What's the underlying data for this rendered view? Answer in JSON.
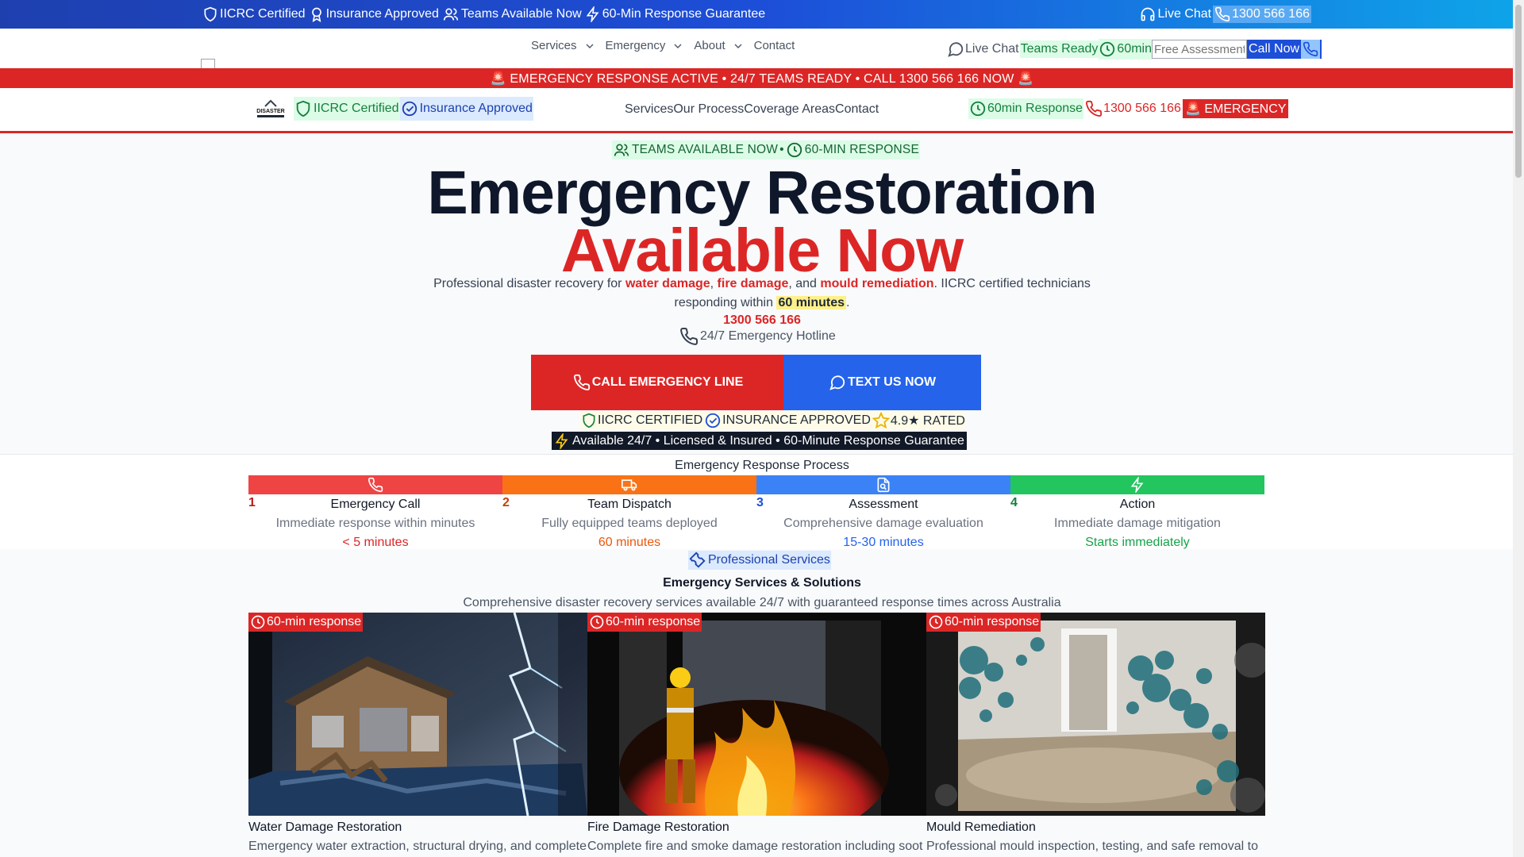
{
  "topbar": {
    "badges": [
      "IICRC Certified",
      "Insurance Approved",
      "Teams Available Now",
      "60-Min Response Guarantee"
    ],
    "live_chat": "Live Chat",
    "phone": "1300 566 166"
  },
  "nav": {
    "links": [
      "Services",
      "Emergency",
      "About",
      "Contact"
    ],
    "live_chat": "Live Chat",
    "teams_ready": "Teams Ready",
    "sixty_min": "60min",
    "free_assessment_placeholder": "Free Assessment",
    "call_now": "Call Now"
  },
  "alert_banner": "🚨 EMERGENCY RESPONSE ACTIVE • 24/7 TEAMS READY • CALL 1300 566 166 NOW 🚨",
  "subheader": {
    "logo_text": "DISASTER",
    "badges": [
      "IICRC Certified",
      "Insurance Approved"
    ],
    "links": [
      "Services",
      "Our Process",
      "Coverage Areas",
      "Contact"
    ],
    "response": "60min Response",
    "phone": "1300 566 166",
    "emergency": "🚨 EMERGENCY"
  },
  "hero": {
    "pill_left": "TEAMS AVAILABLE NOW",
    "pill_sep": "•",
    "pill_right": "60-MIN RESPONSE",
    "title_line1": "Emergency Restoration",
    "title_line2": "Available Now",
    "lead_1": "Professional disaster recovery for ",
    "lead_water": "water damage",
    "lead_2": ", ",
    "lead_fire": "fire damage",
    "lead_3": ", and ",
    "lead_mould": "mould remediation",
    "lead_4": ". IICRC certified technicians responding within ",
    "lead_time": "60 minutes",
    "lead_5": ".",
    "hotline_number": "1300 566 166",
    "hotline_label": "24/7 Emergency Hotline",
    "cta_call": "CALL EMERGENCY LINE",
    "cta_text": "TEXT US NOW",
    "trust": [
      "IICRC CERTIFIED",
      "INSURANCE APPROVED",
      "4.9★ RATED"
    ],
    "strip": "Available 24/7 • Licensed & Insured • 60-Minute Response Guarantee"
  },
  "process": {
    "title": "Emergency Response Process",
    "steps": [
      {
        "num": "1",
        "name": "Emergency Call",
        "desc": "Immediate response within minutes",
        "time": "< 5 minutes",
        "color": "#ef4444",
        "icon": "phone-icon"
      },
      {
        "num": "2",
        "name": "Team Dispatch",
        "desc": "Fully equipped teams deployed",
        "time": "60 minutes",
        "color": "#f97316",
        "icon": "truck-icon"
      },
      {
        "num": "3",
        "name": "Assessment",
        "desc": "Comprehensive damage evaluation",
        "time": "15-30 minutes",
        "color": "#3b82f6",
        "icon": "file-search-icon"
      },
      {
        "num": "4",
        "name": "Action",
        "desc": "Immediate damage mitigation",
        "time": "Starts immediately",
        "color": "#22c55e",
        "icon": "zap-icon"
      }
    ]
  },
  "services": {
    "pill": "Professional Services",
    "title": "Emergency Services & Solutions",
    "subtitle": "Comprehensive disaster recovery services available 24/7 with guaranteed response times across Australia",
    "cards": [
      {
        "tag": "60-min response",
        "title": "Water Damage Restoration",
        "desc": "Emergency water extraction, structural drying, and complete"
      },
      {
        "tag": "60-min response",
        "title": "Fire Damage Restoration",
        "desc": "Complete fire and smoke damage restoration including soot"
      },
      {
        "tag": "60-min response",
        "title": "Mould Remediation",
        "desc": "Professional mould inspection, testing, and safe removal to"
      }
    ]
  },
  "colors": {
    "red": "#dc2626",
    "blue": "#2563eb",
    "green": "#15803d",
    "navy": "#0f172a"
  }
}
